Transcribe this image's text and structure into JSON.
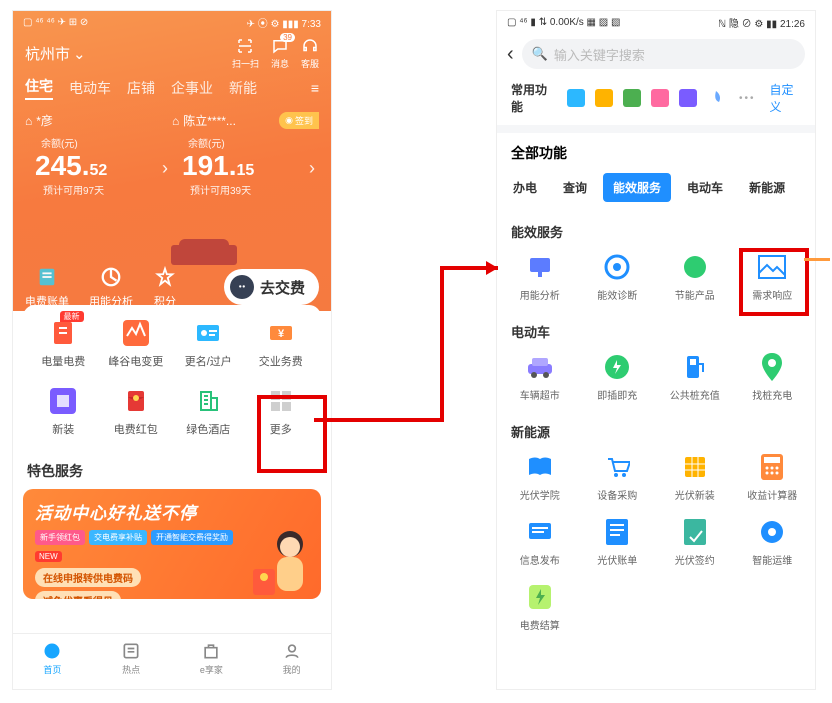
{
  "left": {
    "status": {
      "left": "▢ ⁴⁶ ⁴⁶ ✈ ⊞ ⊘",
      "right": "✈ ⦿ ⚙ ▮▮▮ 7:33"
    },
    "city": "杭州市",
    "topicons": {
      "scan": "扫一扫",
      "msg": "消息",
      "msg_badge": "39",
      "svc": "客服"
    },
    "tabs": [
      "住宅",
      "电动车",
      "店铺",
      "企事业",
      "新能"
    ],
    "accounts": [
      {
        "name": "*彦",
        "bal_label": "余额(元)",
        "int": "245.",
        "dec": "52",
        "days": "预计可用97天"
      },
      {
        "name": "陈立****...",
        "bal_label": "余额(元)",
        "int": "191.",
        "dec": "15",
        "days": "预计可用39天"
      }
    ],
    "signin": "签到",
    "actions": {
      "bill": "电费账单",
      "usage": "用能分析",
      "points": "积分",
      "pay": "去交费"
    },
    "grid": [
      "电量电费",
      "峰谷电变更",
      "更名/过户",
      "交业务费",
      "新装",
      "电费红包",
      "绿色酒店",
      "更多"
    ],
    "grid_new": "最新",
    "special": "特色服务",
    "banner": {
      "title": "活动中心好礼送不停",
      "pills": [
        "新手领红包",
        "交电费享补贴",
        "开通智能交费得奖励"
      ],
      "new": "NEW",
      "line1": "在线申报转供电费码",
      "line2": "减免优惠看得见"
    },
    "tabbar": [
      "首页",
      "热点",
      "e享家",
      "我的"
    ]
  },
  "right": {
    "status": {
      "left": "▢ ⁴⁶ ▮ ⇅ 0.00K/s ▦ ▨ ▧",
      "right": "ℕ 隐 ⊘ ⚙ ▮▮ 21:26"
    },
    "search_placeholder": "输入关键字搜索",
    "fav_label": "常用功能",
    "custom": "自定义",
    "all_label": "全部功能",
    "cats": [
      "办电",
      "查询",
      "能效服务",
      "电动车",
      "新能源"
    ],
    "groups": [
      {
        "title": "能效服务",
        "items": [
          "用能分析",
          "能效诊断",
          "节能产品",
          "需求响应"
        ]
      },
      {
        "title": "电动车",
        "items": [
          "车辆超市",
          "即插即充",
          "公共桩充值",
          "找桩充电"
        ]
      },
      {
        "title": "新能源",
        "items": [
          "光伏学院",
          "设备采购",
          "光伏新装",
          "收益计算器",
          "信息发布",
          "光伏账单",
          "光伏签约",
          "智能运维",
          "电费结算"
        ]
      }
    ]
  }
}
